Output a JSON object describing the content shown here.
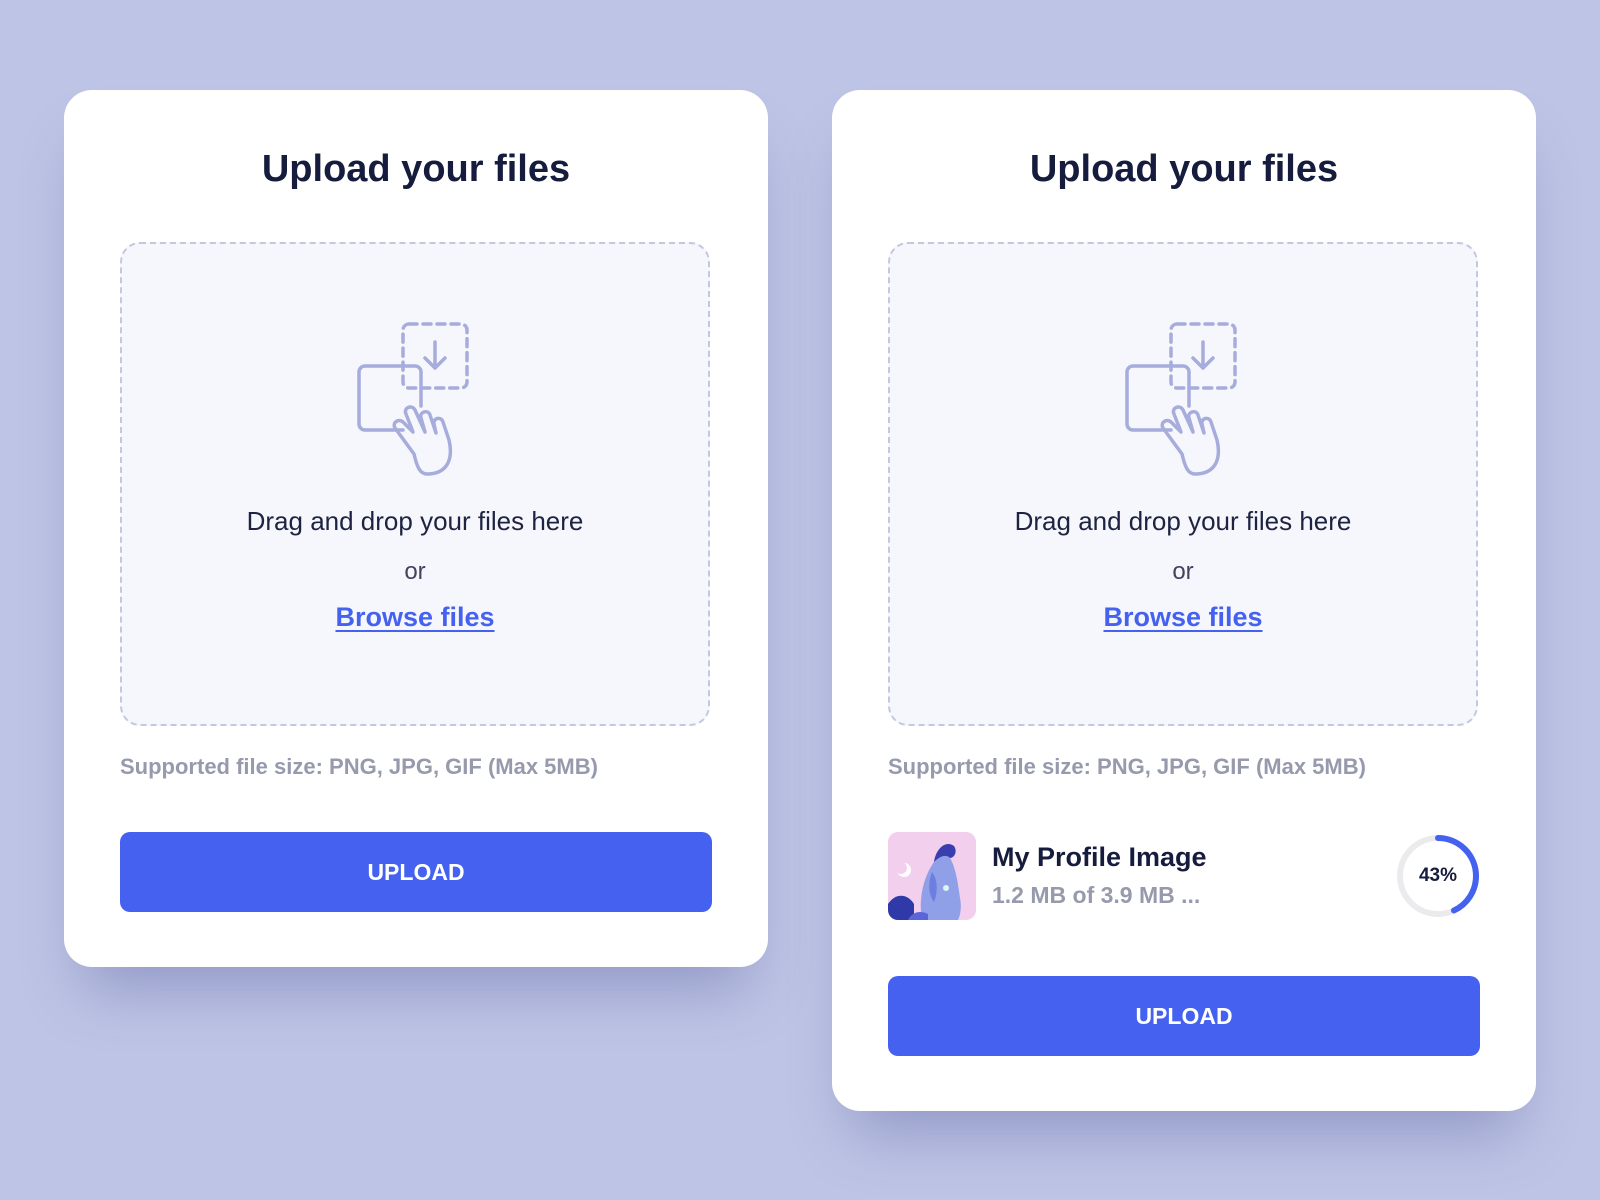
{
  "colors": {
    "background": "#bec4e5",
    "accent": "#4462ef",
    "title": "#161c3d",
    "muted": "#979aac",
    "icon": "#a6acdc",
    "progress_track": "#ebebee"
  },
  "cards": [
    {
      "title": "Upload your files",
      "dropzone": {
        "icon": "drag-drop-hand-icon",
        "text": "Drag and drop your files here",
        "or": "or",
        "browse_label": "Browse files"
      },
      "supported_text": "Supported file size: PNG, JPG, GIF (Max 5MB)",
      "upload_label": "UPLOAD"
    },
    {
      "title": "Upload your files",
      "dropzone": {
        "icon": "drag-drop-hand-icon",
        "text": "Drag and drop your files here",
        "or": "or",
        "browse_label": "Browse files"
      },
      "supported_text": "Supported file size: PNG, JPG, GIF (Max 5MB)",
      "file": {
        "thumbnail_icon": "profile-illustration-thumbnail",
        "name": "My Profile Image",
        "meta": "1.2 MB of 3.9 MB ...",
        "progress": 0.43,
        "progress_label": "43%"
      },
      "upload_label": "UPLOAD"
    }
  ]
}
